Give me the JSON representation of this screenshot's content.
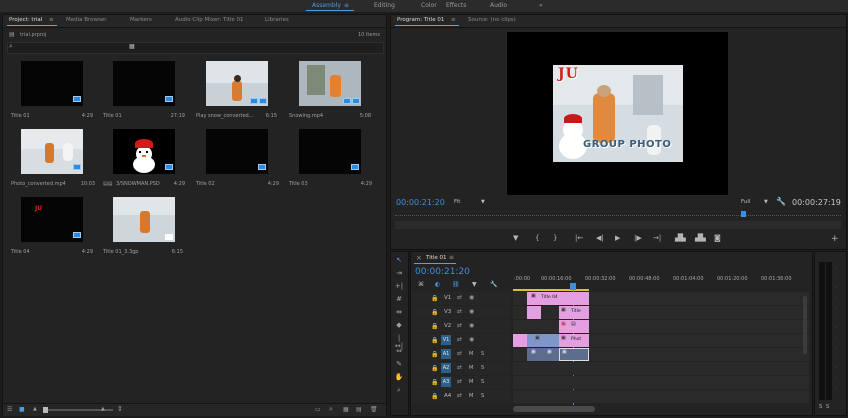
{
  "workspaces": {
    "assembly": "Assembly",
    "editing": "Editing",
    "color": "Color",
    "effects": "Effects",
    "audio": "Audio",
    "more": "»"
  },
  "project_panel": {
    "tabs": [
      "Project: trial",
      "Media Browser",
      "Markers",
      "Audio Clip Mixer: Title 01",
      "Libraries"
    ],
    "file_name": "trial.prproj",
    "item_count": "10 Items",
    "items": [
      {
        "name": "Title 01",
        "duration": "4:29"
      },
      {
        "name": "Title 01",
        "duration": "27:19"
      },
      {
        "name": "Play snow_converted...",
        "duration": "6:15"
      },
      {
        "name": "Snowing.mp4",
        "duration": "5:08"
      },
      {
        "name": "Photo_converted.mp4",
        "duration": "10:03"
      },
      {
        "name": "3/SNOWMAN.PSD",
        "duration": "4:29"
      },
      {
        "name": "Title 02",
        "duration": "4:29"
      },
      {
        "name": "Title 03",
        "duration": "4:29"
      },
      {
        "name": "Title 04",
        "duration": "4:29"
      },
      {
        "name": "Title 01_3.3gp",
        "duration": "6:15"
      }
    ]
  },
  "program_monitor": {
    "tabs": [
      "Program: Title 01",
      "Source: (no clips)"
    ],
    "timecode": "00:00:21:20",
    "fit": "Fit",
    "quality": "Full",
    "duration": "00:00:27:19",
    "overlay_title": "JU",
    "overlay_caption": "GROUP PHOTO"
  },
  "timeline": {
    "tab": "Title 01",
    "timecode": "00:00:21:20",
    "ruler": [
      ":00:00",
      "00:00:16:00",
      "00:00:32:00",
      "00:00:48:00",
      "00:01:04:00",
      "00:01:20:00",
      "00:01:36:00"
    ],
    "tracks": [
      {
        "name": "V1",
        "type": "video"
      },
      {
        "name": "V3",
        "type": "video"
      },
      {
        "name": "V2",
        "type": "video"
      },
      {
        "name": "V1",
        "type": "video",
        "targeted": true
      },
      {
        "name": "A1",
        "type": "audio",
        "targeted": true
      },
      {
        "name": "A2",
        "type": "audio",
        "targeted": true
      },
      {
        "name": "A3",
        "type": "audio",
        "targeted": true
      },
      {
        "name": "A4",
        "type": "audio"
      }
    ],
    "clip_labels": {
      "title04": "Title 04",
      "title": "Title",
      "photo": "Phot"
    },
    "track_letters": {
      "s": "S",
      "m": "M"
    }
  },
  "colors": {
    "accent_blue": "#3d8fe0",
    "clip_pink": "#e39fe0",
    "clip_blue": "#7f97c8",
    "timecode": "#3d8fe0"
  }
}
